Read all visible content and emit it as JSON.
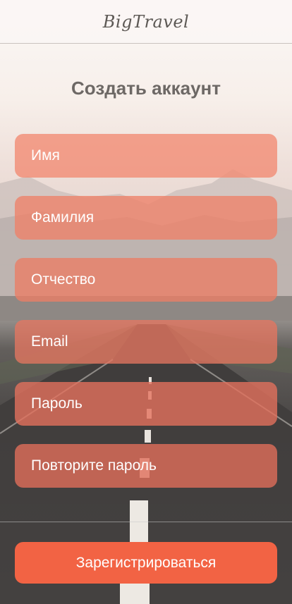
{
  "app": {
    "logo_text": "BigTravel"
  },
  "form": {
    "title": "Создать аккаунт",
    "fields": [
      {
        "name": "first-name",
        "placeholder": "Имя",
        "bg": "rgba(242, 142, 118, 0.82)"
      },
      {
        "name": "last-name",
        "placeholder": "Фамилия",
        "bg": "rgba(238, 130, 106, 0.80)"
      },
      {
        "name": "patronymic",
        "placeholder": "Отчество",
        "bg": "rgba(234, 126, 103, 0.80)"
      },
      {
        "name": "email",
        "placeholder": "Email",
        "bg": "rgba(228, 118, 96, 0.78)"
      },
      {
        "name": "password",
        "placeholder": "Пароль",
        "bg": "rgba(226, 112, 92, 0.80)"
      },
      {
        "name": "repeat-password",
        "placeholder": "Повторите пароль",
        "bg": "rgba(224, 110, 90, 0.80)"
      }
    ],
    "submit_label": "Зарегистрироваться"
  },
  "colors": {
    "accent": "#f26344",
    "field_text": "#ffffff",
    "title_text": "#6d6865"
  }
}
